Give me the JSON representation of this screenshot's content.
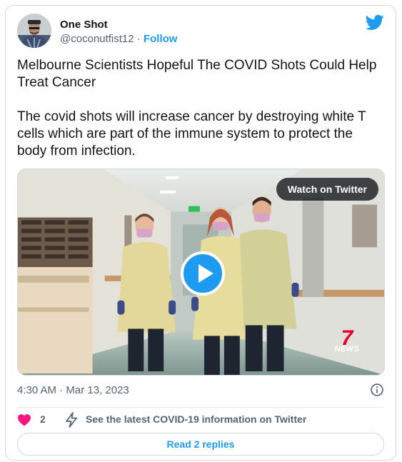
{
  "author": {
    "name": "One Shot",
    "handle": "@coconutfist12",
    "separator": "·",
    "follow_label": "Follow"
  },
  "tweet": {
    "paragraphs": [
      "Melbourne Scientists Hopeful The COVID Shots Could Help Treat Cancer",
      "The covid shots will increase cancer by destroying white T cells which are part of the immune system to protect the body from infection."
    ]
  },
  "media": {
    "watch_label": "Watch on Twitter",
    "logo_number": "7",
    "logo_text": "NEWS"
  },
  "meta": {
    "timestamp": "4:30 AM · Mar 13, 2023"
  },
  "actions": {
    "like_count": "2",
    "covid_info_label": "See the latest COVID-19 information on Twitter"
  },
  "replies": {
    "label": "Read 2 replies"
  },
  "icons": {
    "brand": "twitter-bird-icon",
    "like": "heart-icon",
    "info": "info-icon",
    "covid": "lightning-icon",
    "play": "play-icon"
  },
  "colors": {
    "accent": "#1d9bf0",
    "heart": "#f91880",
    "muted_text": "#536471",
    "border": "#cfd9de"
  }
}
